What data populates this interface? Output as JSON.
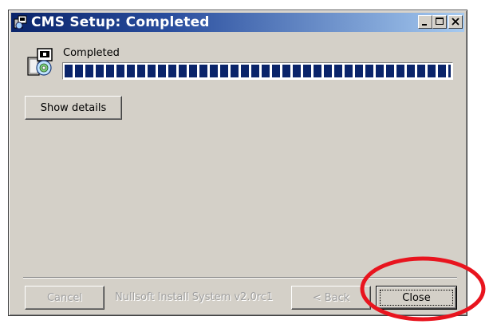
{
  "window": {
    "title": "CMS Setup: Completed"
  },
  "status": {
    "text": "Completed",
    "progress_percent": 100
  },
  "buttons": {
    "show_details": "Show details",
    "cancel": "Cancel",
    "back": "< Back",
    "close": "Close"
  },
  "branding": "Nullsoft Install System v2.0rc1",
  "colors": {
    "dialog_bg": "#d4d0c8",
    "titlebar": "#0a246a",
    "progress_fill": "#0a246a",
    "highlight_circle": "#e8141e"
  },
  "icons": [
    "installer-app-icon",
    "minimize-icon",
    "maximize-icon",
    "close-icon",
    "setup-package-icon"
  ]
}
